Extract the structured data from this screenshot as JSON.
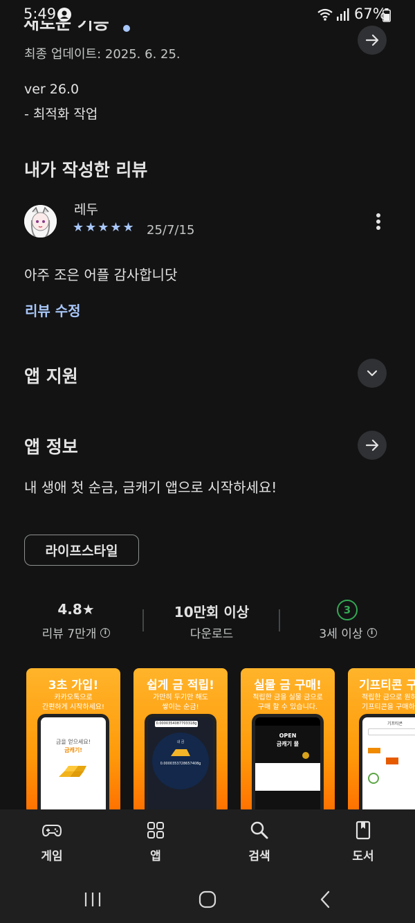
{
  "status_bar": {
    "time": "5:49",
    "battery": "67%"
  },
  "whats_new": {
    "title_partial": "새로운 기능",
    "last_updated": "최종 업데이트: 2025. 6. 25.",
    "version": "ver 26.0",
    "change": "- 최적화 작업"
  },
  "my_review": {
    "section_title": "내가 작성한 리뷰",
    "reviewer": "레두",
    "stars": "★★★★★",
    "date": "25/7/15",
    "text": "아주 조은 어플 감사합니닷",
    "edit_label": "리뷰 수정"
  },
  "app_support": {
    "title": "앱 지원"
  },
  "app_info": {
    "title": "앱 정보",
    "description": "내 생애 첫 순금, 금캐기 앱으로 시작하세요!",
    "category": "라이프스타일"
  },
  "stats": {
    "rating": "4.8★",
    "reviews": "리뷰 7만개",
    "downloads": "10만회 이상",
    "downloads_label": "다운로드",
    "age_badge": "3",
    "age_label": "3세 이상"
  },
  "screenshots": [
    {
      "title": "3초 가입!",
      "subtitle": "카카오톡으로\n간편하게 시작하세요!"
    },
    {
      "title": "쉽게 금 적립!",
      "subtitle": "가만히 두기만 해도\n쌓이는 순금!"
    },
    {
      "title": "실물 금 구매!",
      "subtitle": "적립한 금을 실물 금으로\n구매 할 수 있습니다."
    },
    {
      "title": "기프티콘 구",
      "subtitle": "적립한 금으로 원하\n기프티콘을 구매하세"
    }
  ],
  "screenshot_inner": {
    "s1_line1": "금을 얻으세요!",
    "s1_line2": "금캐기!",
    "s2_top": "0.0000354087703318g",
    "s2_label": "내 금",
    "s2_amount": "0.0000353728657408g",
    "s3_banner1": "OPEN",
    "s3_banner2": "금캐기 몰",
    "s4_header": "기프티콘"
  },
  "bottom_nav": {
    "items": [
      {
        "label": "게임",
        "icon": "gamepad-icon"
      },
      {
        "label": "앱",
        "icon": "apps-grid-icon"
      },
      {
        "label": "검색",
        "icon": "search-icon"
      },
      {
        "label": "도서",
        "icon": "book-icon"
      }
    ]
  },
  "colors": {
    "background": "#131314",
    "accent_blue": "#a8c7fa",
    "age_green": "#34a853",
    "screenshot_orange": "#ff9a0a"
  }
}
